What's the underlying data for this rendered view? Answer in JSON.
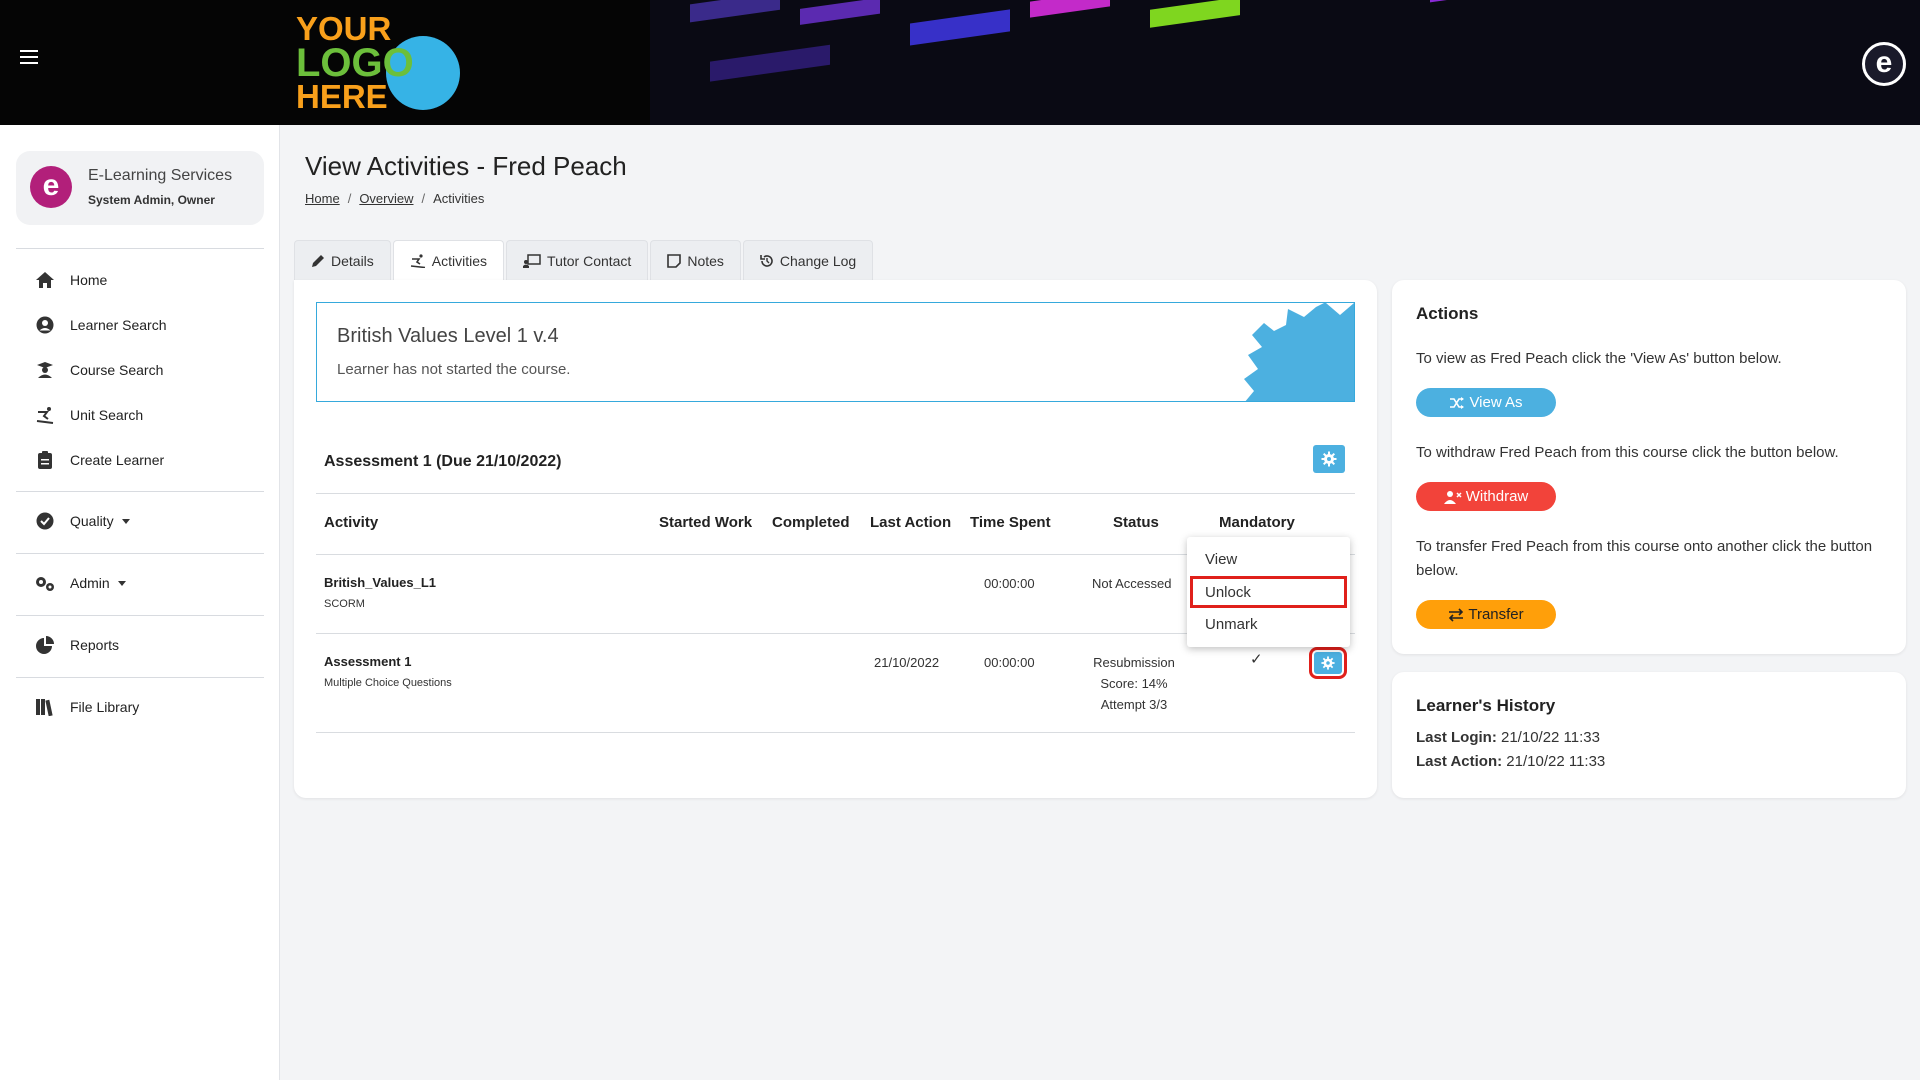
{
  "header": {
    "logo_text": [
      "YOUR",
      "LOGO",
      "HERE"
    ],
    "corner_logo": "e"
  },
  "sidebar": {
    "profile": {
      "logo": "e",
      "name": "E-Learning Services",
      "role": "System Admin, Owner"
    },
    "nav": [
      {
        "label": "Home",
        "icon": "home-icon"
      },
      {
        "label": "Learner Search",
        "icon": "user-circle-icon"
      },
      {
        "label": "Course Search",
        "icon": "graduate-icon"
      },
      {
        "label": "Unit Search",
        "icon": "skier-icon"
      },
      {
        "label": "Create Learner",
        "icon": "clipboard-icon"
      },
      {
        "label": "Quality",
        "icon": "check-circle-icon"
      },
      {
        "label": "Admin",
        "icon": "gears-icon"
      },
      {
        "label": "Reports",
        "icon": "pie-chart-icon"
      },
      {
        "label": "File Library",
        "icon": "books-icon"
      }
    ]
  },
  "page": {
    "title": "View Activities - Fred Peach",
    "breadcrumb": {
      "home": "Home",
      "overview": "Overview",
      "current": "Activities",
      "separator": "/"
    }
  },
  "tabs": [
    {
      "label": "Details",
      "icon": "pencil-icon"
    },
    {
      "label": "Activities",
      "icon": "skier-icon",
      "active": true
    },
    {
      "label": "Tutor Contact",
      "icon": "chalkboard-icon"
    },
    {
      "label": "Notes",
      "icon": "note-icon"
    },
    {
      "label": "Change Log",
      "icon": "history-icon"
    }
  ],
  "course": {
    "title": "British Values Level 1 v.4",
    "status": "Learner has not started the course."
  },
  "assessment": {
    "title": "Assessment 1 (Due 21/10/2022)",
    "columns": [
      "Activity",
      "Started Work",
      "Completed",
      "Last Action",
      "Time Spent",
      "Status",
      "Mandatory"
    ],
    "rows": [
      {
        "name": "British_Values_L1",
        "type": "SCORM",
        "started": "",
        "completed": "",
        "last_action": "",
        "time_spent": "00:00:00",
        "status": "Not Accessed",
        "mandatory": ""
      },
      {
        "name": "Assessment 1",
        "type": "Multiple Choice Questions",
        "started": "",
        "completed": "",
        "last_action": "21/10/2022",
        "time_spent": "00:00:00",
        "status": "Resubmission",
        "score": "Score: 14%",
        "attempt": "Attempt 3/3",
        "mandatory": "✓"
      }
    ]
  },
  "dropdown": {
    "items": [
      "View",
      "Unlock",
      "Unmark"
    ],
    "highlighted": "Unlock"
  },
  "actions": {
    "title": "Actions",
    "view_as_text": "To view as Fred Peach click the 'View As' button below.",
    "view_as_label": "View As",
    "withdraw_text": "To withdraw Fred Peach from this course click the button below.",
    "withdraw_label": "Withdraw",
    "transfer_text": "To transfer Fred Peach from this course onto another click the button below.",
    "transfer_label": "Transfer"
  },
  "history": {
    "title": "Learner's History",
    "last_login_label": "Last Login:",
    "last_login": "21/10/22 11:33",
    "last_action_label": "Last Action:",
    "last_action": "21/10/22 11:33"
  },
  "colors": {
    "accent_blue": "#4cb0e0",
    "withdraw_red": "#f2433a",
    "transfer_orange": "#ff9f0a",
    "highlight_red": "#e0201b",
    "logo_orange": "#f9a01b",
    "logo_green": "#6cbf3b",
    "brand_magenta": "#b21f7a"
  }
}
